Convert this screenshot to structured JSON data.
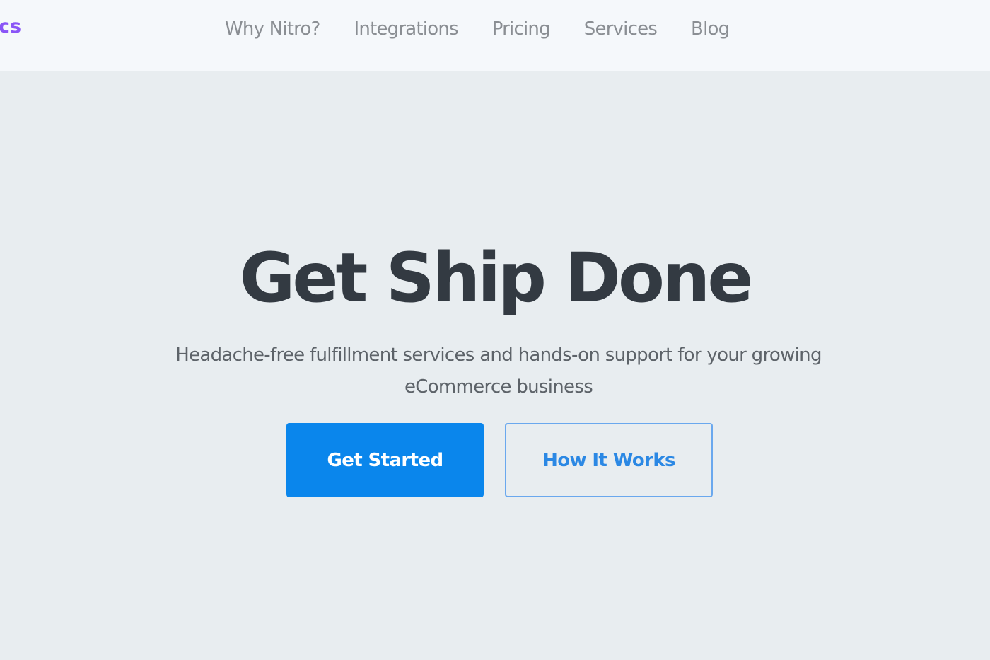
{
  "header": {
    "logo_text": "cs",
    "nav": [
      {
        "label": "Why Nitro?"
      },
      {
        "label": "Integrations"
      },
      {
        "label": "Pricing"
      },
      {
        "label": "Services"
      },
      {
        "label": "Blog"
      }
    ]
  },
  "hero": {
    "title": "Get Ship Done",
    "subtitle": "Headache-free fulfillment services and hands-on support for your growing eCommerce business",
    "primary_button": "Get Started",
    "secondary_button": "How It Works"
  },
  "colors": {
    "brand": "#8a55f7",
    "primary": "#0a86ec",
    "title": "#333a42",
    "background": "#e8edf0",
    "header_background": "#f5f8fb"
  }
}
